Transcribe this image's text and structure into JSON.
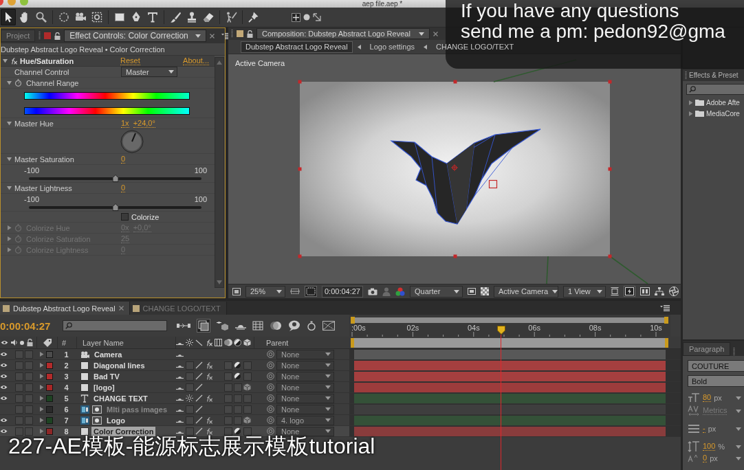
{
  "window": {
    "title": "aep file.aep *"
  },
  "toolbar": {
    "tools": [
      {
        "selected": true
      },
      {
        "selected": false
      },
      {
        "selected": false
      },
      {
        "selected": false
      },
      {
        "selected": false
      },
      {
        "selected": false
      },
      {
        "selected": false
      },
      {
        "selected": false
      },
      {
        "selected": false
      },
      {
        "selected": false
      },
      {
        "selected": false
      },
      {
        "selected": false
      },
      {
        "selected": false
      },
      {
        "selected": false
      }
    ]
  },
  "effect_controls": {
    "tabs": [
      {
        "label": "Project",
        "selected": false
      },
      {
        "label": "Effect Controls: Color Correction",
        "selected": true
      }
    ],
    "subtitle": "Dubstep Abstract Logo Reveal • Color Correction",
    "effect": {
      "name": "Hue/Saturation",
      "expanded": true,
      "reset": "Reset",
      "about": "About..."
    },
    "properties": [
      {
        "kind": "dropdown",
        "label": "Channel Control",
        "value": "Master"
      },
      {
        "kind": "range",
        "label": "Channel Range",
        "expanded": true
      },
      {
        "kind": "dial",
        "label": "Master Hue",
        "expanded": true,
        "revolutions": "1x",
        "value": "+24,0°"
      },
      {
        "kind": "slider",
        "label": "Master Saturation",
        "expanded": true,
        "value": "0",
        "min": "-100",
        "max": "100",
        "level": 0.5
      },
      {
        "kind": "slider",
        "label": "Master Lightness",
        "expanded": true,
        "value": "0",
        "min": "-100",
        "max": "100",
        "level": 0.5
      },
      {
        "kind": "checkbox",
        "label": "Colorize",
        "checked": false
      },
      {
        "kind": "angle",
        "label": "Colorize Hue",
        "expanded": false,
        "disabled": true,
        "revolutions": "0x",
        "value": "+0,0°"
      },
      {
        "kind": "number",
        "label": "Colorize Saturation",
        "expanded": false,
        "disabled": true,
        "value": "25"
      },
      {
        "kind": "number",
        "label": "Colorize Lightness",
        "expanded": false,
        "disabled": true,
        "value": "0"
      }
    ]
  },
  "composition": {
    "tab": {
      "label": "Composition: Dubstep Abstract Logo Reveal"
    },
    "breadcrumbs": [
      {
        "label": "Dubstep Abstract Logo Reveal",
        "selected": true
      },
      {
        "label": "Logo settings",
        "selected": false
      },
      {
        "label": "CHANGE LOGO/TEXT",
        "selected": false
      }
    ],
    "view_label": "Active Camera",
    "footer": {
      "magnification": "25%",
      "timecode": "0:00:04:27",
      "resolution": "Quarter",
      "camera": "Active Camera",
      "views": "1 View"
    }
  },
  "timeline": {
    "tabs": [
      {
        "label": "Dubstep Abstract Logo Reveal",
        "selected": true
      },
      {
        "label": "CHANGE LOGO/TEXT",
        "selected": false
      }
    ],
    "timecode": "0:00:04:27",
    "columns": {
      "number": "#",
      "name": "Layer Name",
      "parent": "Parent"
    },
    "ruler": [
      ":00s",
      "02s",
      "04s",
      "06s",
      "08s",
      "10s"
    ],
    "playhead": {
      "level": 0.49
    },
    "layers": [
      {
        "number": "1",
        "name": "Camera",
        "kind": "camera",
        "color": "#4c4c4c",
        "visible": true,
        "expanded": false,
        "selected": false,
        "effects": false,
        "adjustment": false,
        "three_d": false,
        "parent": "None"
      },
      {
        "number": "2",
        "name": "Diagonal lines",
        "kind": "solid",
        "color": "#b32b2b",
        "visible": true,
        "expanded": false,
        "selected": false,
        "effects": true,
        "adjustment": true,
        "three_d": false,
        "parent": "None"
      },
      {
        "number": "3",
        "name": "Bad TV",
        "kind": "solid",
        "color": "#b32b2b",
        "visible": true,
        "expanded": false,
        "selected": false,
        "effects": true,
        "adjustment": true,
        "three_d": false,
        "parent": "None"
      },
      {
        "number": "4",
        "name": "[logo]",
        "kind": "solid",
        "color": "#a82727",
        "visible": true,
        "expanded": false,
        "selected": false,
        "effects": false,
        "adjustment": false,
        "three_d": true,
        "parent": "None"
      },
      {
        "number": "5",
        "name": "CHANGE TEXT",
        "kind": "text",
        "color": "#1d4322",
        "visible": true,
        "expanded": false,
        "selected": false,
        "effects": true,
        "adjustment": false,
        "three_d": false,
        "parent": "None"
      },
      {
        "number": "6",
        "name": "Mlti pass images",
        "kind": "precomp",
        "color": "#2a2a2a",
        "visible": false,
        "expanded": false,
        "selected": false,
        "effects": false,
        "adjustment": false,
        "three_d": false,
        "parent": "None"
      },
      {
        "number": "7",
        "name": "Logo",
        "kind": "precomp",
        "color": "#1d4322",
        "visible": true,
        "expanded": false,
        "selected": false,
        "effects": true,
        "adjustment": false,
        "three_d": true,
        "parent": "4. logo"
      },
      {
        "number": "8",
        "name": "Color Correction",
        "kind": "solid",
        "color": "#8e2727",
        "visible": true,
        "expanded": false,
        "selected": true,
        "effects": true,
        "adjustment": true,
        "three_d": false,
        "parent": "None"
      }
    ]
  },
  "effects_presets": {
    "title": "Effects & Preset",
    "items": [
      {
        "label": "Adobe Afte",
        "expanded": false
      },
      {
        "label": "MediaCore",
        "expanded": false
      }
    ]
  },
  "paragraph": {
    "tabs": [
      {
        "label": "Paragraph",
        "selected": false
      }
    ],
    "font": "COUTURE",
    "style": "Bold",
    "size": {
      "value": "80",
      "unit": "px"
    },
    "kerning": "Metrics",
    "leading": {
      "value": "-",
      "unit": "px"
    },
    "vertical_scale": {
      "value": "100",
      "unit": "%"
    },
    "baseline_shift": {
      "value": "0",
      "unit": "px"
    }
  },
  "overlay": {
    "lines": [
      "If you have any questions",
      "send me a pm: pedon92@gma"
    ]
  },
  "caption": "227-AE模板-能源标志展示模板tutorial"
}
